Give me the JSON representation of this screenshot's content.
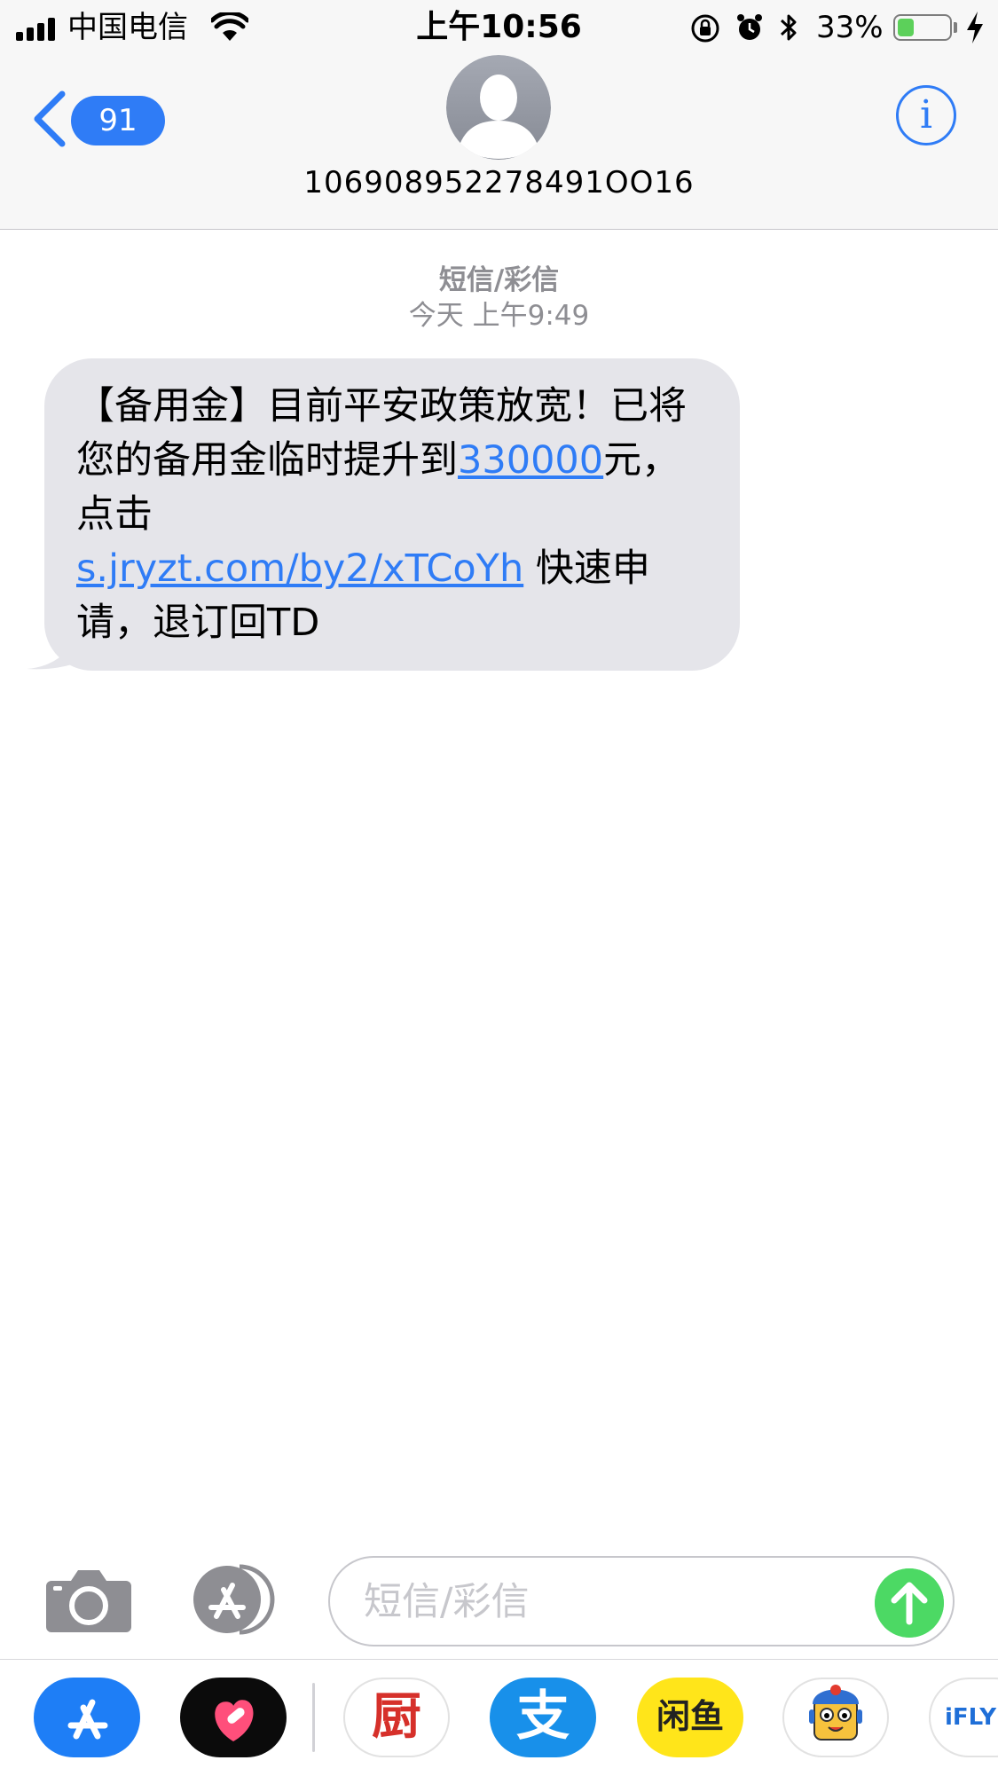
{
  "status_bar": {
    "carrier": "中国电信",
    "time": "上午10:56",
    "battery_percent": "33%",
    "battery_level": 0.33
  },
  "header": {
    "back_badge": "91",
    "contact_name": "106908952278491OO16",
    "info_label": "i"
  },
  "thread": {
    "message_type": "短信/彩信",
    "timestamp": "今天 上午9:49",
    "message": {
      "text_before_amount": "【备用金】目前平安政策放宽！已将您的备用金临时提升到",
      "amount_link": "330000",
      "text_after_amount": "元，点击",
      "url_link": "s.jryzt.com/by2/xTCoYh",
      "text_end": " 快速申请，退订回TD"
    }
  },
  "compose": {
    "placeholder": "短信/彩信"
  },
  "app_drawer": {
    "apps": [
      {
        "name": "app-store-icon",
        "label": ""
      },
      {
        "name": "heart-app-icon",
        "label": ""
      },
      {
        "name": "kitchen-app-icon",
        "label": "厨"
      },
      {
        "name": "alipay-icon",
        "label": "支"
      },
      {
        "name": "xianyu-icon",
        "label": "闲鱼"
      },
      {
        "name": "cartoon-sticker-icon",
        "label": ""
      },
      {
        "name": "ifly-icon",
        "label": "iFLY"
      }
    ]
  },
  "colors": {
    "accent": "#2f7cf6",
    "send": "#4cd964",
    "bubble": "#e5e5ea"
  }
}
